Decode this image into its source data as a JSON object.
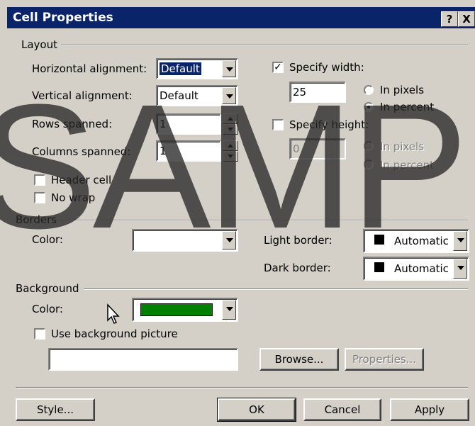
{
  "dialog": {
    "title": "Cell Properties",
    "help_label": "?",
    "close_label": "X"
  },
  "layout": {
    "group_label": "Layout",
    "horizontal_alignment": {
      "label": "Horizontal alignment:",
      "value": "Default"
    },
    "vertical_alignment": {
      "label": "Vertical alignment:",
      "value": "Default"
    },
    "rows_spanned": {
      "label": "Rows spanned:",
      "value": "1"
    },
    "columns_spanned": {
      "label": "Columns spanned:",
      "value": "1"
    },
    "header_cell": {
      "label": "Header cell",
      "checked": false
    },
    "no_wrap": {
      "label": "No wrap",
      "checked": false
    },
    "specify_width": {
      "label": "Specify width:",
      "checked": true,
      "value": "25",
      "unit_pixels": "In pixels",
      "unit_percent": "In percent",
      "selected": "percent"
    },
    "specify_height": {
      "label": "Specify height:",
      "checked": false,
      "value": "0",
      "unit_pixels": "In pixels",
      "unit_percent": "In percent"
    }
  },
  "borders": {
    "group_label": "Borders",
    "color_label": "Color:",
    "color_value": "",
    "light_border_label": "Light border:",
    "light_border_value": "Automatic",
    "dark_border_label": "Dark border:",
    "dark_border_value": "Automatic"
  },
  "background": {
    "group_label": "Background",
    "color_label": "Color:",
    "color_hex": "#008000",
    "use_picture": {
      "label": "Use background picture",
      "checked": false
    },
    "picture_path": "",
    "browse_label": "Browse...",
    "properties_label": "Properties..."
  },
  "footer": {
    "style_label": "Style...",
    "ok_label": "OK",
    "cancel_label": "Cancel",
    "apply_label": "Apply"
  },
  "watermark": "SAMP",
  "colors": {
    "title_bar": "#0a246a",
    "dialog_bg": "#d4d0c8",
    "background_color": "#008000"
  }
}
